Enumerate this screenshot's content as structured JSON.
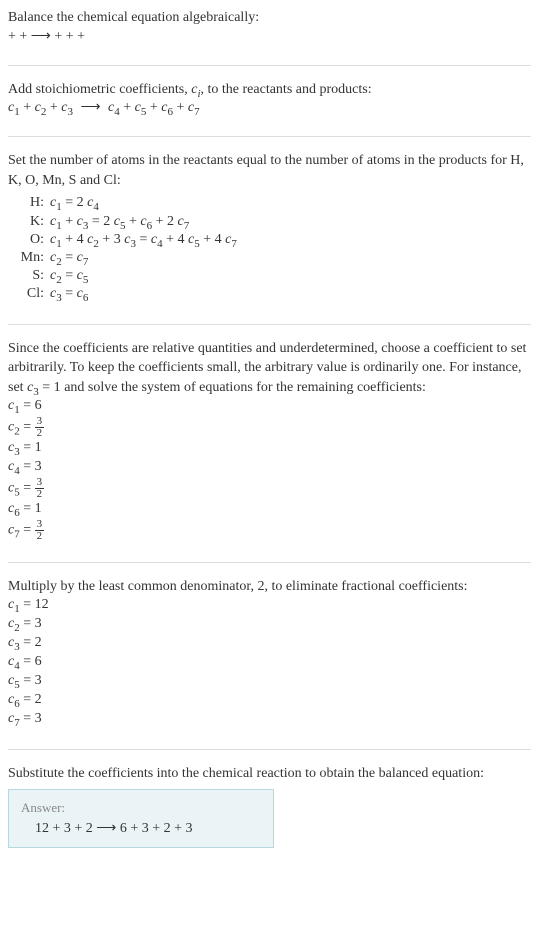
{
  "intro": {
    "line1": "Balance the chemical equation algebraically:",
    "eq": " +  +  ⟶  +  +  + "
  },
  "stoich": {
    "line1_pre": "Add stoichiometric coefficients, ",
    "line1_mid": "c",
    "line1_sub": "i",
    "line1_post": ", to the reactants and products:",
    "eq": "c₁  + c₂  + c₃  ⟶ c₄  + c₅  + c₆  + c₇"
  },
  "atoms": {
    "intro": "Set the number of atoms in the reactants equal to the number of atoms in the products for H, K, O, Mn, S and Cl:",
    "rows": [
      {
        "label": "H:",
        "eq": "c₁ = 2 c₄"
      },
      {
        "label": "K:",
        "eq": "c₁ + c₃ = 2 c₅ + c₆ + 2 c₇"
      },
      {
        "label": "O:",
        "eq": "c₁ + 4 c₂ + 3 c₃ = c₄ + 4 c₅ + 4 c₇"
      },
      {
        "label": "Mn:",
        "eq": "c₂ = c₇"
      },
      {
        "label": "S:",
        "eq": "c₂ = c₅"
      },
      {
        "label": "Cl:",
        "eq": "c₃ = c₆"
      }
    ]
  },
  "choose": {
    "intro_pre": "Since the coefficients are relative quantities and underdetermined, choose a coefficient to set arbitrarily. To keep the coefficients small, the arbitrary value is ordinarily one. For instance, set ",
    "intro_c": "c₃ = 1",
    "intro_post": " and solve the system of equations for the remaining coefficients:",
    "lines": [
      {
        "lhs": "c₁",
        "val": "6",
        "frac": false
      },
      {
        "lhs": "c₂",
        "num": "3",
        "den": "2",
        "frac": true
      },
      {
        "lhs": "c₃",
        "val": "1",
        "frac": false
      },
      {
        "lhs": "c₄",
        "val": "3",
        "frac": false
      },
      {
        "lhs": "c₅",
        "num": "3",
        "den": "2",
        "frac": true
      },
      {
        "lhs": "c₆",
        "val": "1",
        "frac": false
      },
      {
        "lhs": "c₇",
        "num": "3",
        "den": "2",
        "frac": true
      }
    ]
  },
  "multiply": {
    "intro": "Multiply by the least common denominator, 2, to eliminate fractional coefficients:",
    "lines": [
      {
        "lhs": "c₁",
        "val": "12"
      },
      {
        "lhs": "c₂",
        "val": "3"
      },
      {
        "lhs": "c₃",
        "val": "2"
      },
      {
        "lhs": "c₄",
        "val": "6"
      },
      {
        "lhs": "c₅",
        "val": "3"
      },
      {
        "lhs": "c₆",
        "val": "2"
      },
      {
        "lhs": "c₇",
        "val": "3"
      }
    ]
  },
  "substitute": {
    "intro": "Substitute the coefficients into the chemical reaction to obtain the balanced equation:"
  },
  "answer": {
    "label": "Answer:",
    "eq": "12  + 3  + 2  ⟶ 6  + 3  + 2  + 3"
  }
}
